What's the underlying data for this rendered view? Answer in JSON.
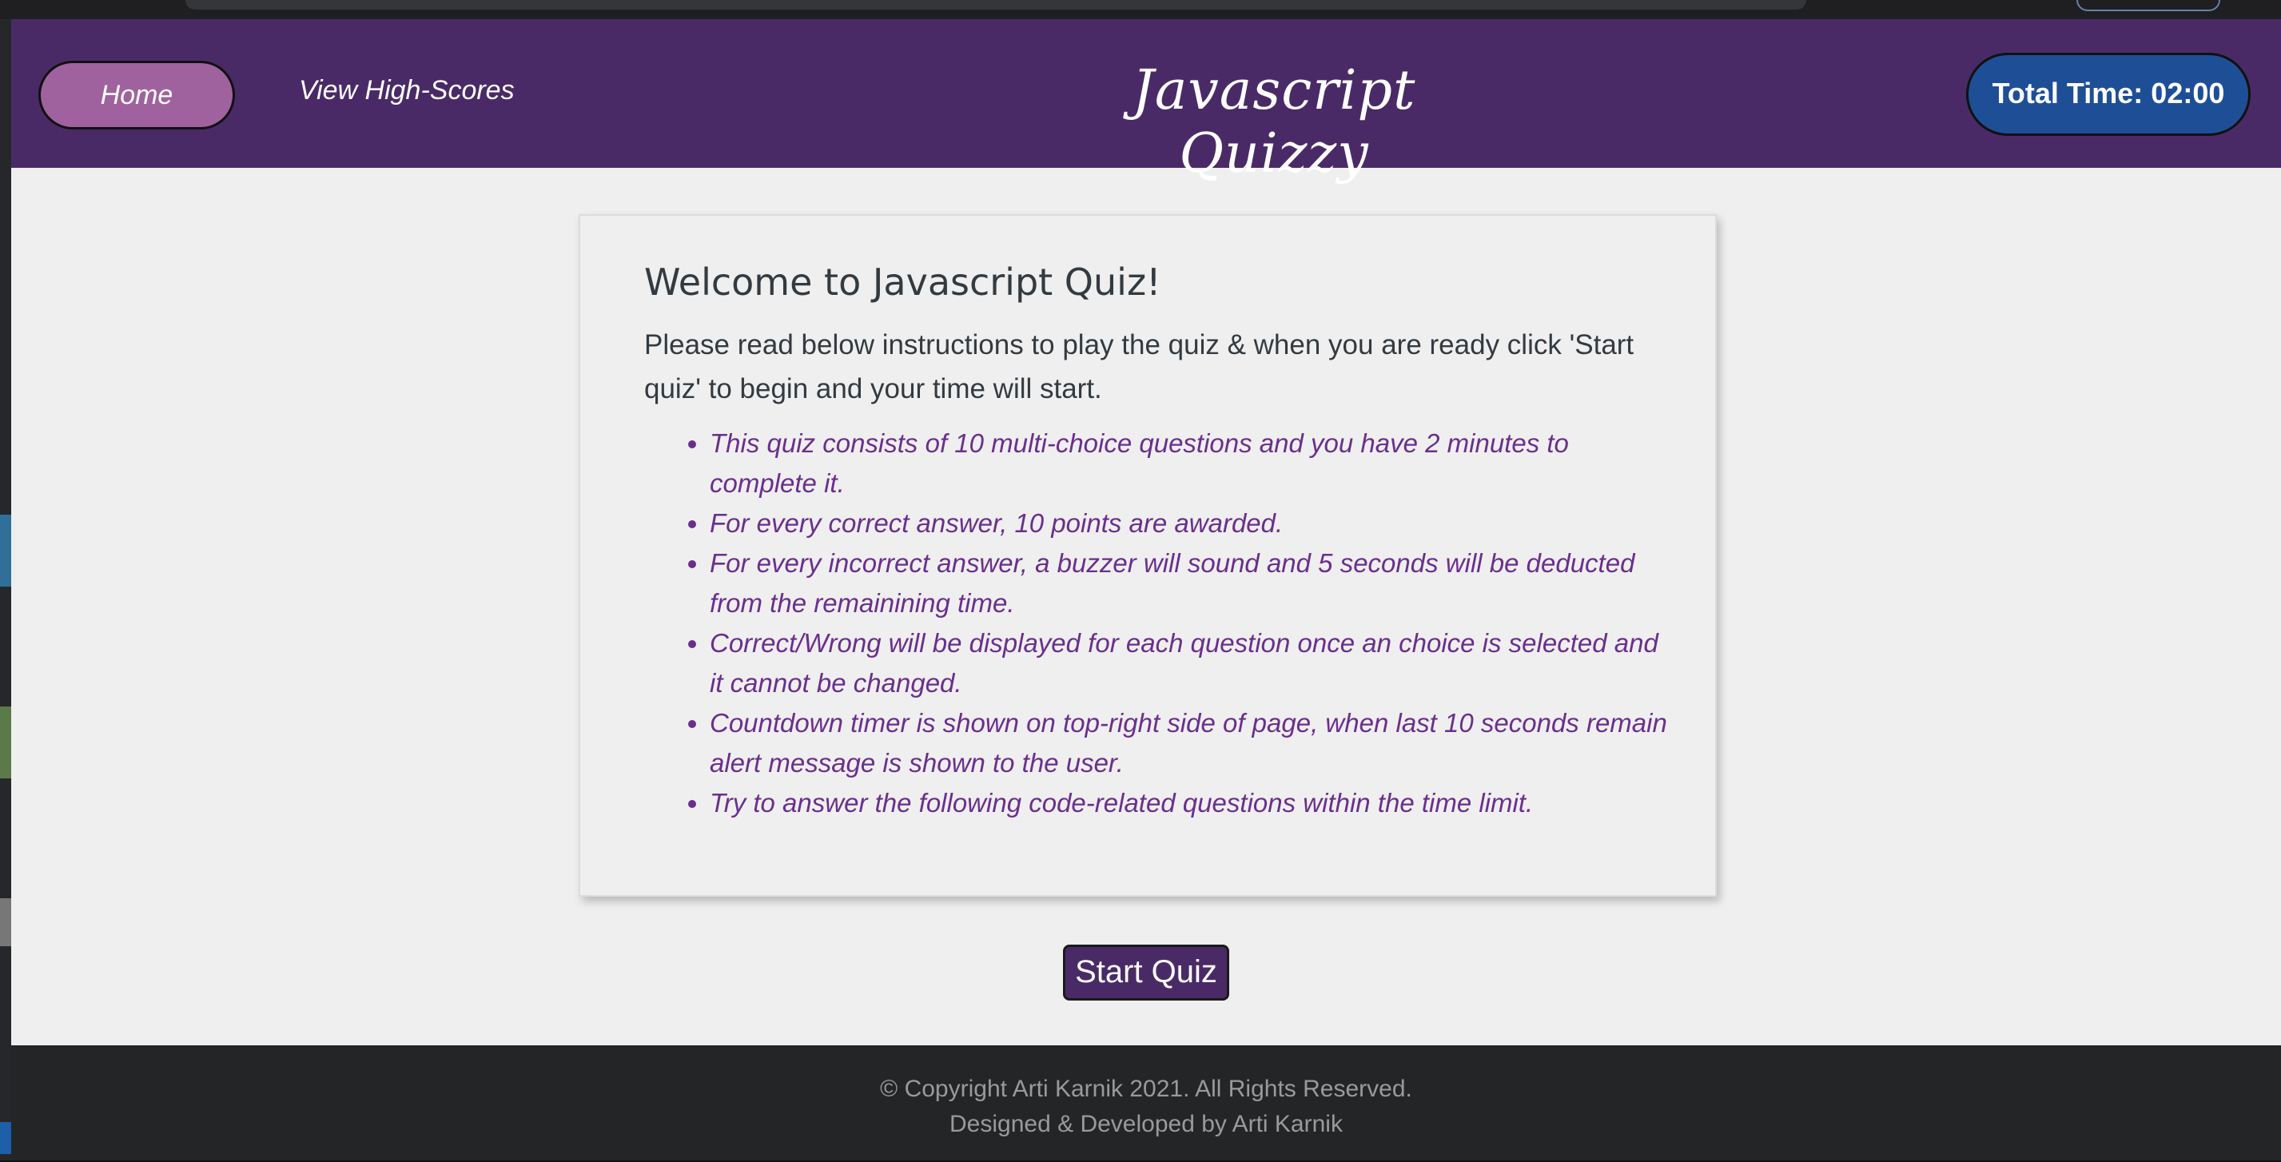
{
  "nav": {
    "home_label": "Home",
    "highscores_label": "View High-Scores"
  },
  "header": {
    "title": "Javascript Quizzy",
    "timer_label": "Total Time: 02:00"
  },
  "card": {
    "heading": "Welcome to Javascript Quiz!",
    "intro": "Please read below instructions to play the quiz & when you are ready click 'Start quiz' to begin and your time will start.",
    "rules": [
      "This quiz consists of 10 multi-choice questions and you have 2 minutes to complete it.",
      "For every correct answer, 10 points are awarded.",
      "For every incorrect answer, a buzzer will sound and 5 seconds will be deducted from the remainining time.",
      "Correct/Wrong will be displayed for each question once an choice is selected and it cannot be changed.",
      "Countdown timer is shown on top-right side of page, when last 10 seconds remain alert message is shown to the user.",
      "Try to answer the following code-related questions within the time limit."
    ]
  },
  "actions": {
    "start_label": "Start Quiz"
  },
  "footer": {
    "copyright": "© Copyright Arti Karnik 2021. All Rights Reserved.",
    "credits": "Designed & Developed by Arti Karnik"
  },
  "colors": {
    "header_bg": "#4a2a66",
    "home_button": "#a0629e",
    "timer_bg": "#1e4f96",
    "rule_text": "#6a2f8c",
    "footer_bg": "#242527"
  }
}
